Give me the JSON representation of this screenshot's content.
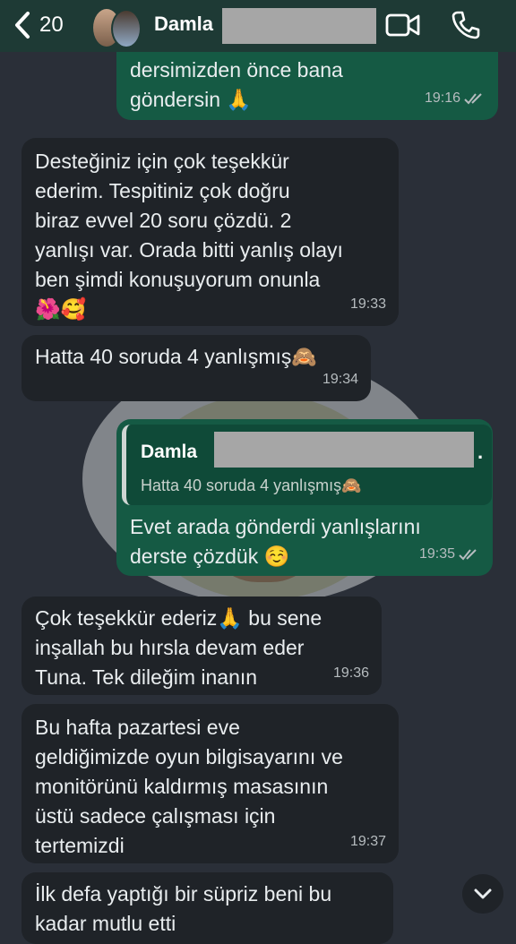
{
  "header": {
    "back_count": "20",
    "contact_name": "Damla",
    "icons": [
      "back-chevron-icon",
      "video-call-icon",
      "phone-call-icon"
    ]
  },
  "messages": [
    {
      "direction": "out",
      "text": "dersimizden önce bana\ngöndersin 🙏",
      "time": "19:16",
      "read": true
    },
    {
      "direction": "in",
      "text": "Desteğiniz için çok teşekkür\nederim. Tespitiniz çok doğru\nbiraz evvel 20 soru çözdü. 2\nyanlışı var. Orada bitti yanlış olayı\nben şimdi konuşuyorum onunla\n🌺🥰",
      "time": "19:33"
    },
    {
      "direction": "in",
      "text": "Hatta 40 soruda 4 yanlışmış🙈",
      "time": "19:34"
    },
    {
      "direction": "out",
      "quote": {
        "name": "Damla",
        "dot": ".",
        "text": "Hatta 40 soruda 4 yanlışmış🙈"
      },
      "text": "Evet arada gönderdi yanlışlarını\nderste çözdük ☺️",
      "time": "19:35",
      "read": true
    },
    {
      "direction": "in",
      "text": "Çok teşekkür ederiz🙏 bu sene\ninşallah bu hırsla devam eder\nTuna. Tek dileğim inanın",
      "time": "19:36"
    },
    {
      "direction": "in",
      "text": "Bu hafta pazartesi eve\ngeldiğimizde oyun bilgisayarını ve\nmonitörünü kaldırmış masasının\nüstü sadece çalışması için\ntertemizdi",
      "time": "19:37"
    },
    {
      "direction": "in",
      "text": "İlk defa yaptığı bir süpriz beni bu\nkadar mutlu etti",
      "time": ""
    }
  ],
  "colors": {
    "header": "#1e3a35",
    "incoming": "#1f2328",
    "outgoing": "#155a44",
    "background": "#2a2f38"
  }
}
